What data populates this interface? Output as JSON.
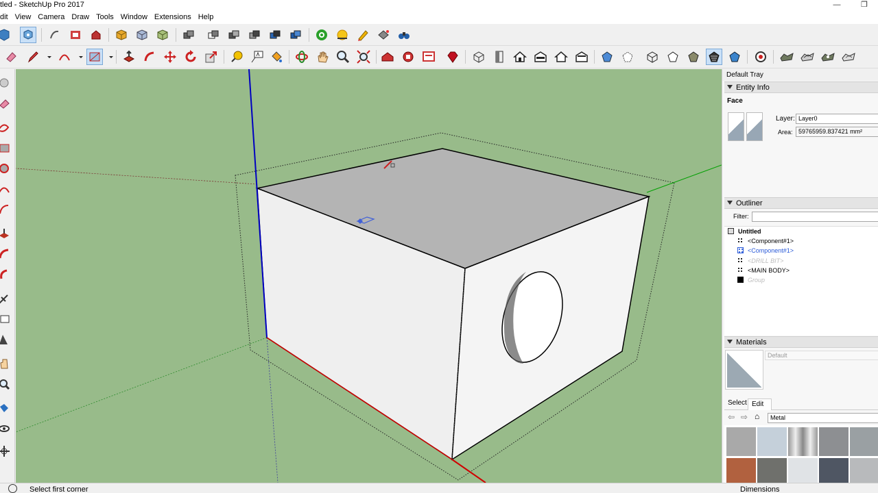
{
  "window": {
    "title": "tled - SketchUp Pro 2017",
    "minimize_glyph": "—",
    "restore_glyph": "❐"
  },
  "menu": [
    "dit",
    "View",
    "Camera",
    "Draw",
    "Tools",
    "Window",
    "Extensions",
    "Help"
  ],
  "toolbar1_icons": [
    "orbit-select-icon",
    "component-icon",
    "follow-me-icon",
    "paint-icon",
    "warehouse-icon",
    "shaded-box-icon",
    "xray-box-icon",
    "textured-box-icon",
    "solid-union-icon",
    "solid-intersect-icon",
    "solid-subtract-icon",
    "solid-trim-icon",
    "solid-split-icon",
    "solid-outer-icon",
    "location-icon",
    "shadows-icon",
    "fog-icon",
    "section-icon",
    "binoculars-icon"
  ],
  "toolbar2_icons": [
    "eraser-icon",
    "pencil-icon",
    "arc-icon",
    "rectangle-icon",
    "push-pull-icon",
    "follow-me-tool-icon",
    "move-icon",
    "rotate-icon",
    "scale-icon",
    "tape-measure-icon",
    "text-icon",
    "paint-bucket-icon",
    "orbit-icon",
    "pan-icon",
    "zoom-icon",
    "zoom-extents-icon",
    "warehouse-3d-icon",
    "extension-warehouse-icon",
    "layout-send-icon",
    "ruby-icon",
    "iso-view-icon",
    "top-view-icon",
    "front-view-icon",
    "right-view-icon",
    "back-view-icon",
    "left-view-icon",
    "xray-style-icon",
    "back-edges-icon",
    "wireframe-icon",
    "hidden-line-icon",
    "shaded-icon",
    "shaded-textures-icon",
    "monochrome-icon",
    "section-plane-icon",
    "sandbox-contours-icon",
    "sandbox-scratch-icon",
    "sandbox-smoove-icon",
    "sandbox-stamp-icon"
  ],
  "left_toolbar_icons": [
    "select-arrow-icon",
    "eraser-left-icon",
    "freehand-icon",
    "rect-left-icon",
    "circle-left-icon",
    "arc-left-icon",
    "pie-left-icon",
    "pushpull-left-icon",
    "followme-left-icon",
    "move-left-icon",
    "tape-left-icon",
    "text-left-icon",
    "axes-left-icon",
    "pan-left-icon",
    "zoom-left-icon",
    "walk-left-icon",
    "look-around-icon",
    "position-camera-icon"
  ],
  "tray": {
    "title": "Default Tray",
    "entity_info": {
      "header": "Entity Info",
      "type": "Face",
      "layer_label": "Layer:",
      "layer_value": "Layer0",
      "area_label": "Area:",
      "area_value": "59765959.837421 mm²"
    },
    "outliner": {
      "header": "Outliner",
      "filter_label": "Filter:",
      "filter_value": "",
      "root": "Untitled",
      "items": [
        {
          "label": "<Component#1>",
          "style": "normal"
        },
        {
          "label": "<Component#1>",
          "style": "selected"
        },
        {
          "label": "<DRILL BIT>",
          "style": "hidden"
        },
        {
          "label": "<MAIN BODY>",
          "style": "normal"
        },
        {
          "label": "Group",
          "style": "hidden"
        }
      ]
    },
    "materials": {
      "header": "Materials",
      "current_name": "Default",
      "select_tab": "Select",
      "edit_tab": "Edit",
      "library": "Metal",
      "swatch_colors": [
        "#a9a9a9",
        "#c5d0da",
        "#bfbfbf",
        "#8d8f92",
        "#9aa0a3",
        "#b1613f",
        "#6f706c",
        "#e0e3e6",
        "#4f5663",
        "#b8babc"
      ]
    }
  },
  "status": {
    "message": "Select first corner",
    "dimensions_label": "Dimensions"
  },
  "colors": {
    "viewport_bg": "#98bb8a",
    "axis_red": "#d00000",
    "axis_green": "#00a000",
    "axis_blue": "#0000c0",
    "selected_item": "#2a5ad8"
  }
}
